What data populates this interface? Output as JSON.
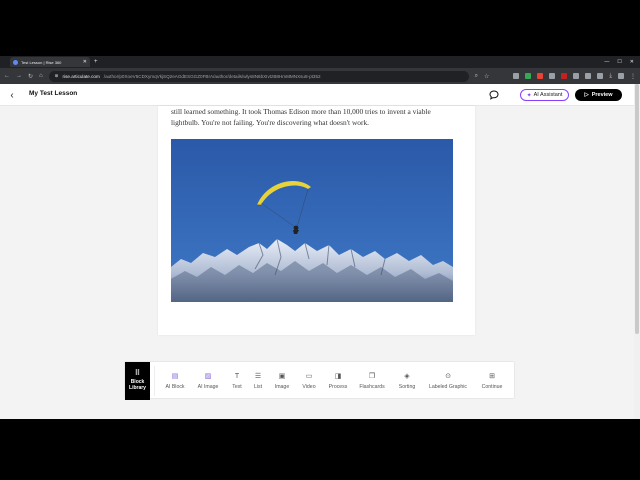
{
  "browser": {
    "tab_title": "Test Lesson | Rise 360",
    "url_host": "rise.articulate.com",
    "url_path": "/author/p0XoeV5CDXymqVkjSQ2eAGdESGGZ0FBrA/author/details/wlys8N6bXIvtzB8HmMMNXsu8-pt352",
    "colors": {
      "chrome": "#202124",
      "bar": "#35363a"
    }
  },
  "header": {
    "title": "My Test Lesson",
    "ai_assistant_label": "AI Assistant",
    "preview_label": "Preview"
  },
  "content": {
    "paragraph": "still learned something. It took Thomas Edison more than 10,000 tries to invent a viable lightbulb. You're not failing. You're discovering what doesn't work.",
    "image_icon": "paraglider-mountains-photo"
  },
  "toolbar": {
    "block_library": "Block Library",
    "items": [
      {
        "label": "AI Block",
        "icon": "ai-block-icon"
      },
      {
        "label": "AI Image",
        "icon": "ai-image-icon"
      },
      {
        "label": "Text",
        "icon": "text-icon"
      },
      {
        "label": "List",
        "icon": "list-icon"
      },
      {
        "label": "Image",
        "icon": "image-icon"
      },
      {
        "label": "Video",
        "icon": "video-icon"
      },
      {
        "label": "Process",
        "icon": "process-icon"
      },
      {
        "label": "Flashcards",
        "icon": "flashcards-icon"
      },
      {
        "label": "Sorting",
        "icon": "sorting-icon"
      },
      {
        "label": "Labeled Graphic",
        "icon": "labeled-graphic-icon"
      },
      {
        "label": "Continue",
        "icon": "continue-icon"
      }
    ]
  },
  "colors": {
    "accent": "#8a3ffc",
    "ai_icon": "#7b5cd6",
    "sky": "#2e5fae",
    "wing": "#e6d23a"
  }
}
